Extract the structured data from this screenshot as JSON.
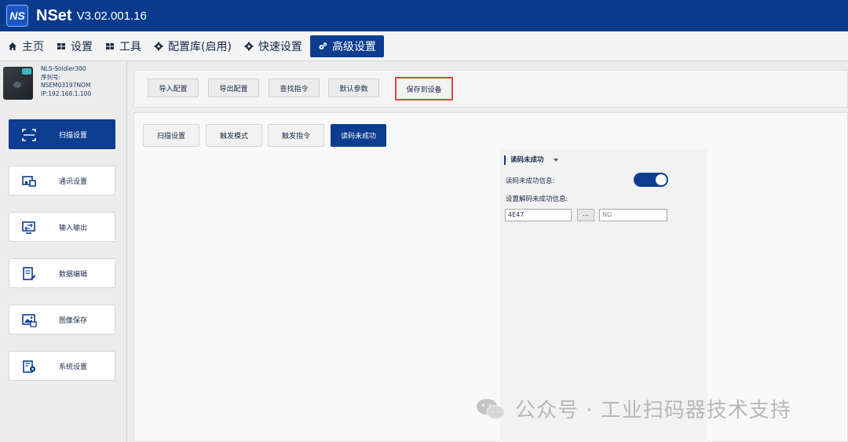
{
  "titlebar": {
    "logo": "NS",
    "app_name": "NSet",
    "version": "V3.02.001.16"
  },
  "menu": [
    {
      "label": "主页",
      "icon": "home-icon"
    },
    {
      "label": "设置",
      "icon": "grid-icon"
    },
    {
      "label": "工具",
      "icon": "tools-icon"
    },
    {
      "label": "配置库(启用)",
      "icon": "gear-icon"
    },
    {
      "label": "快速设置",
      "icon": "gear-icon"
    },
    {
      "label": "高级设置",
      "icon": "gears-icon",
      "active": true
    }
  ],
  "device": {
    "model": "NLS-Soldier300",
    "serial_label": "序列号:",
    "serial": "NSEM03197NOM",
    "ip": "IP:192.168.1.100"
  },
  "sidebar": [
    {
      "label": "扫描设置",
      "icon": "scan-icon",
      "active": true
    },
    {
      "label": "通讯设置",
      "icon": "device-link-icon"
    },
    {
      "label": "输入输出",
      "icon": "monitor-io-icon"
    },
    {
      "label": "数据编辑",
      "icon": "edit-document-icon"
    },
    {
      "label": "图像保存",
      "icon": "image-save-icon"
    },
    {
      "label": "系统设置",
      "icon": "system-settings-icon"
    }
  ],
  "toolbar": {
    "import": "导入配置",
    "export": "导出配置",
    "find": "查找指令",
    "default": "默认参数",
    "save": "保存到设备"
  },
  "tabs": [
    {
      "label": "扫描设置"
    },
    {
      "label": "触发模式"
    },
    {
      "label": "触发指令"
    },
    {
      "label": "读码未成功",
      "active": true
    }
  ],
  "panel": {
    "title": "读码未成功",
    "fail_info_label": "读码未成功信息:",
    "fail_info_enabled": true,
    "set_label": "设置解码未成功信息:",
    "hex_value": "4E47",
    "browse_label": "...",
    "text_value": "NG"
  },
  "watermark": {
    "text": "公众号 · 工业扫码器技术支持"
  },
  "colors": {
    "primary": "#0d3d8e",
    "highlight_border": "#e8443a"
  }
}
